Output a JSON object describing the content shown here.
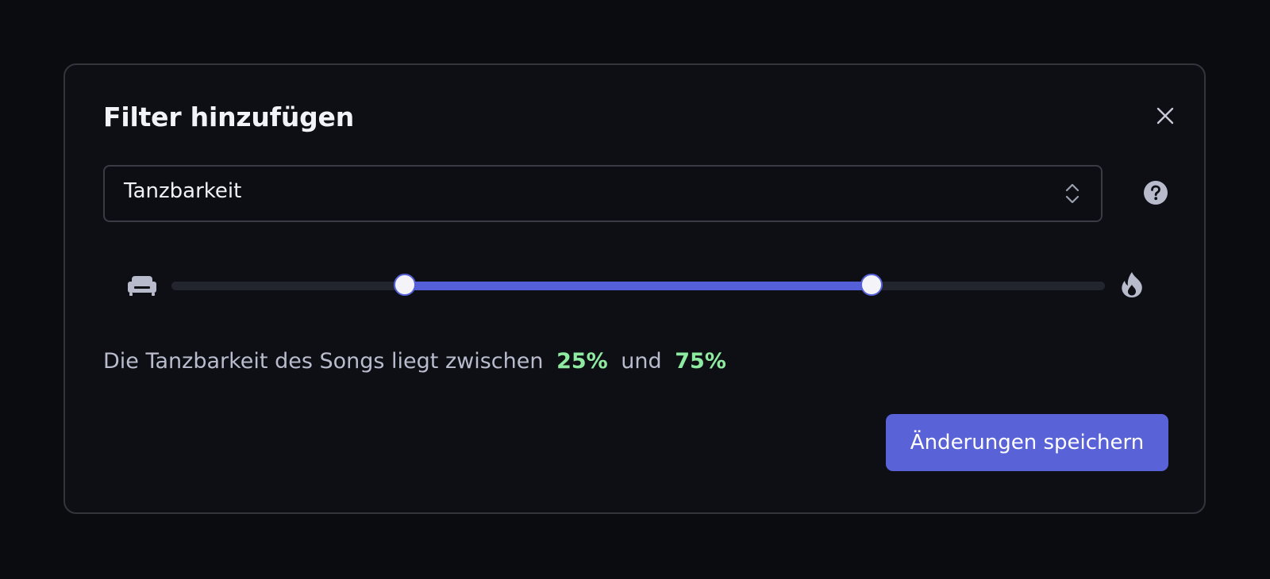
{
  "dialog": {
    "title": "Filter hinzufügen",
    "close_icon": "close-icon"
  },
  "select": {
    "value": "Tanzbarkeit",
    "chevron_icon": "chevron-up-down-icon"
  },
  "help": {
    "icon": "question-circle-icon"
  },
  "slider": {
    "min_icon": "sofa-icon",
    "max_icon": "flame-icon",
    "range_min_percent": 25,
    "range_max_percent": 75
  },
  "summary": {
    "prefix": "Die Tanzbarkeit des Songs liegt zwischen",
    "min_label": "25%",
    "connector": "und",
    "max_label": "75%"
  },
  "actions": {
    "save_label": "Änderungen speichern"
  },
  "colors": {
    "accent": "#5a62d8",
    "highlight_green": "#8eeaa0",
    "background": "#0b0c10",
    "modal_background": "#0e0f15"
  }
}
